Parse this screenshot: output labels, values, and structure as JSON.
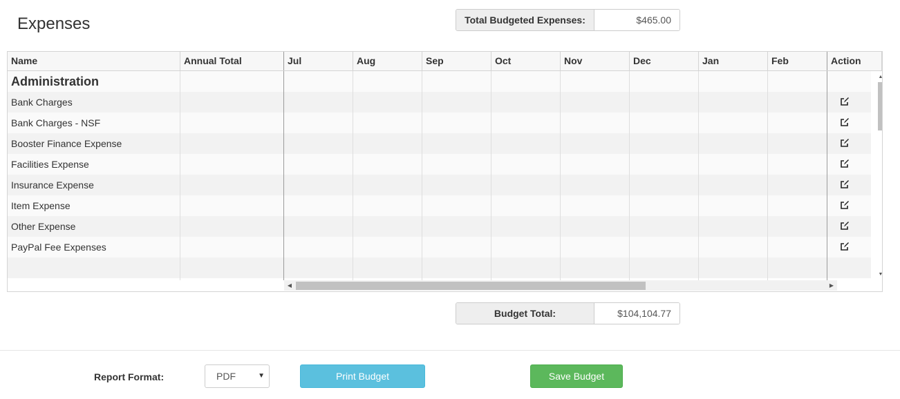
{
  "page": {
    "title": "Expenses"
  },
  "summary": {
    "total_budgeted_label": "Total Budgeted Expenses:",
    "total_budgeted_value": "$465.00",
    "budget_total_label": "Budget Total:",
    "budget_total_value": "$104,104.77"
  },
  "grid": {
    "columns": [
      "Name",
      "Annual Total",
      "Jul",
      "Aug",
      "Sep",
      "Oct",
      "Nov",
      "Dec",
      "Jan",
      "Feb",
      "Action"
    ],
    "group": "Administration",
    "rows": [
      {
        "name": "Bank Charges"
      },
      {
        "name": "Bank Charges - NSF"
      },
      {
        "name": "Booster Finance Expense"
      },
      {
        "name": "Facilities Expense"
      },
      {
        "name": "Insurance Expense"
      },
      {
        "name": "Item Expense"
      },
      {
        "name": "Other Expense"
      },
      {
        "name": "PayPal Fee Expenses"
      }
    ]
  },
  "footer": {
    "report_format_label": "Report Format:",
    "report_format_value": "PDF",
    "print_button": "Print Budget",
    "save_button": "Save Budget"
  },
  "colors": {
    "print_button": "#5bc0de",
    "save_button": "#5cb85c",
    "row_alt": "#f2f2f2",
    "header_bg": "#f7f7f7"
  }
}
